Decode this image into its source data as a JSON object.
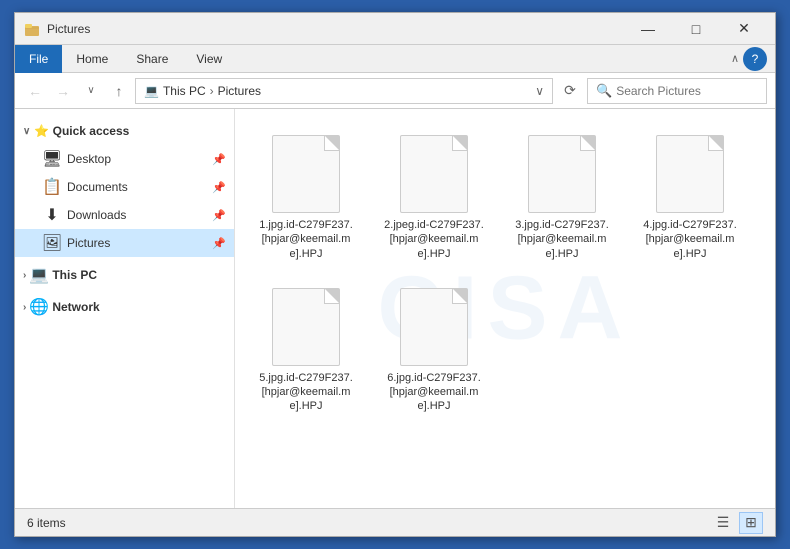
{
  "window": {
    "title": "Pictures",
    "title_icon": "folder"
  },
  "ribbon": {
    "tabs": [
      "File",
      "Home",
      "Share",
      "View"
    ],
    "active_tab": "Home",
    "chevron_label": "∧",
    "help_label": "?"
  },
  "address_bar": {
    "back_label": "←",
    "forward_label": "→",
    "down_label": "∨",
    "up_label": "↑",
    "path": [
      "This PC",
      "Pictures"
    ],
    "path_icon": "💻",
    "dropdown_label": "∨",
    "refresh_label": "⟳",
    "search_placeholder": "Search Pictures"
  },
  "sidebar": {
    "quick_access_label": "Quick access",
    "items_quick": [
      {
        "name": "Desktop",
        "icon": "🖥",
        "pinned": true
      },
      {
        "name": "Documents",
        "icon": "📄",
        "pinned": true
      },
      {
        "name": "Downloads",
        "icon": "⬇",
        "pinned": true
      },
      {
        "name": "Pictures",
        "icon": "🖼",
        "pinned": true,
        "selected": true
      }
    ],
    "this_pc_label": "This PC",
    "network_label": "Network"
  },
  "files": [
    {
      "name": "1.jpg.id-C279F237.[hpjar@keemail.me].HPJ"
    },
    {
      "name": "2.jpeg.id-C279F237.[hpjar@keemail.me].HPJ"
    },
    {
      "name": "3.jpg.id-C279F237.[hpjar@keemail.me].HPJ"
    },
    {
      "name": "4.jpg.id-C279F237.[hpjar@keemail.me].HPJ"
    },
    {
      "name": "5.jpg.id-C279F237.[hpjar@keemail.me].HPJ"
    },
    {
      "name": "6.jpg.id-C279F237.[hpjar@keemail.me].HPJ"
    }
  ],
  "status": {
    "count_label": "6 items"
  },
  "title_bar_controls": {
    "minimize": "—",
    "maximize": "□",
    "close": "✕"
  }
}
